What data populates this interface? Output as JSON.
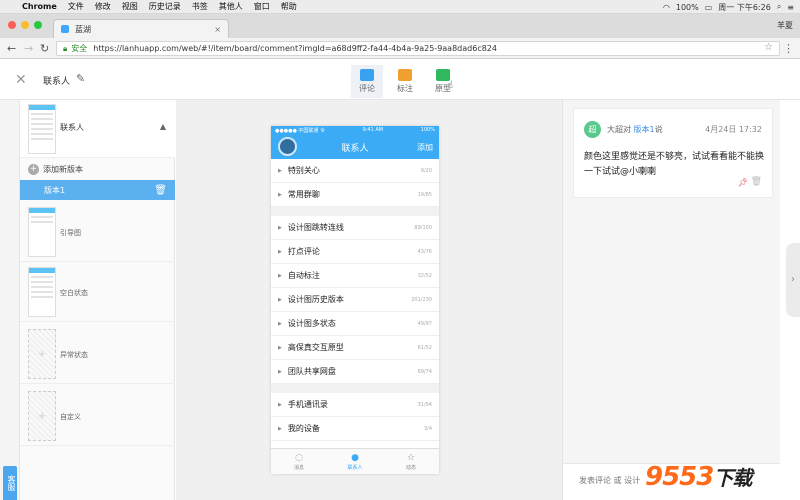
{
  "mac": {
    "menus": [
      "Chrome",
      "文件",
      "修改",
      "视图",
      "历史记录",
      "书签",
      "其他人",
      "窗口",
      "帮助"
    ],
    "battery": "100%",
    "clock": "周一 下午6:26"
  },
  "browser": {
    "tab_title": "蓝湖",
    "user": "羊夏",
    "secure": "安全",
    "url": "https://lanhuapp.com/web/#!/item/board/comment?imgId=a68d9ff2-fa44-4b4a-9a25-9aa8dad6c824"
  },
  "toolbar": {
    "title": "联系人",
    "tools": [
      {
        "label": "评论",
        "color": "#3aa0f0"
      },
      {
        "label": "标注",
        "color": "#f0a030"
      },
      {
        "label": "原型",
        "color": "#2fb85e"
      }
    ]
  },
  "sidebar": {
    "current_page": "联系人",
    "add_version": "添加新版本",
    "version": "版本1",
    "pages": [
      "引导图",
      "空白状态",
      "异常状态",
      "自定义"
    ],
    "left_tab": "客服"
  },
  "phone": {
    "carrier": "●●●●● 中国联通 令",
    "time": "9:41 AM",
    "battery": "100%",
    "title": "联系人",
    "right": "添加",
    "groups": [
      [
        {
          "name": "特别关心",
          "count": "9/20"
        },
        {
          "name": "常用群聊",
          "count": "19/85"
        }
      ],
      [
        {
          "name": "设计图跳转连线",
          "count": "89/100"
        },
        {
          "name": "打点评论",
          "count": "43/76"
        },
        {
          "name": "自动标注",
          "count": "32/52"
        },
        {
          "name": "设计图历史版本",
          "count": "201/230"
        },
        {
          "name": "设计图多状态",
          "count": "49/97"
        },
        {
          "name": "高保真交互原型",
          "count": "61/52"
        },
        {
          "name": "团队共享网盘",
          "count": "69/74"
        }
      ],
      [
        {
          "name": "手机通讯录",
          "count": "31/94"
        },
        {
          "name": "我的设备",
          "count": "3/4"
        }
      ]
    ],
    "tabs": [
      {
        "label": "消息",
        "icon": "◌"
      },
      {
        "label": "联系人",
        "icon": "●"
      },
      {
        "label": "动态",
        "icon": "☆"
      }
    ]
  },
  "comment": {
    "avatar": "超",
    "author": "大超对",
    "version": "版本1",
    "said": "说",
    "date": "4月24日 17:32",
    "text": "颜色这里感觉还是不够亮，试试看看能不能换一下试试@小喇喇",
    "placeholder": "发表评论 或 设计"
  },
  "watermark": {
    "main": "9553",
    "suffix": "下载"
  }
}
